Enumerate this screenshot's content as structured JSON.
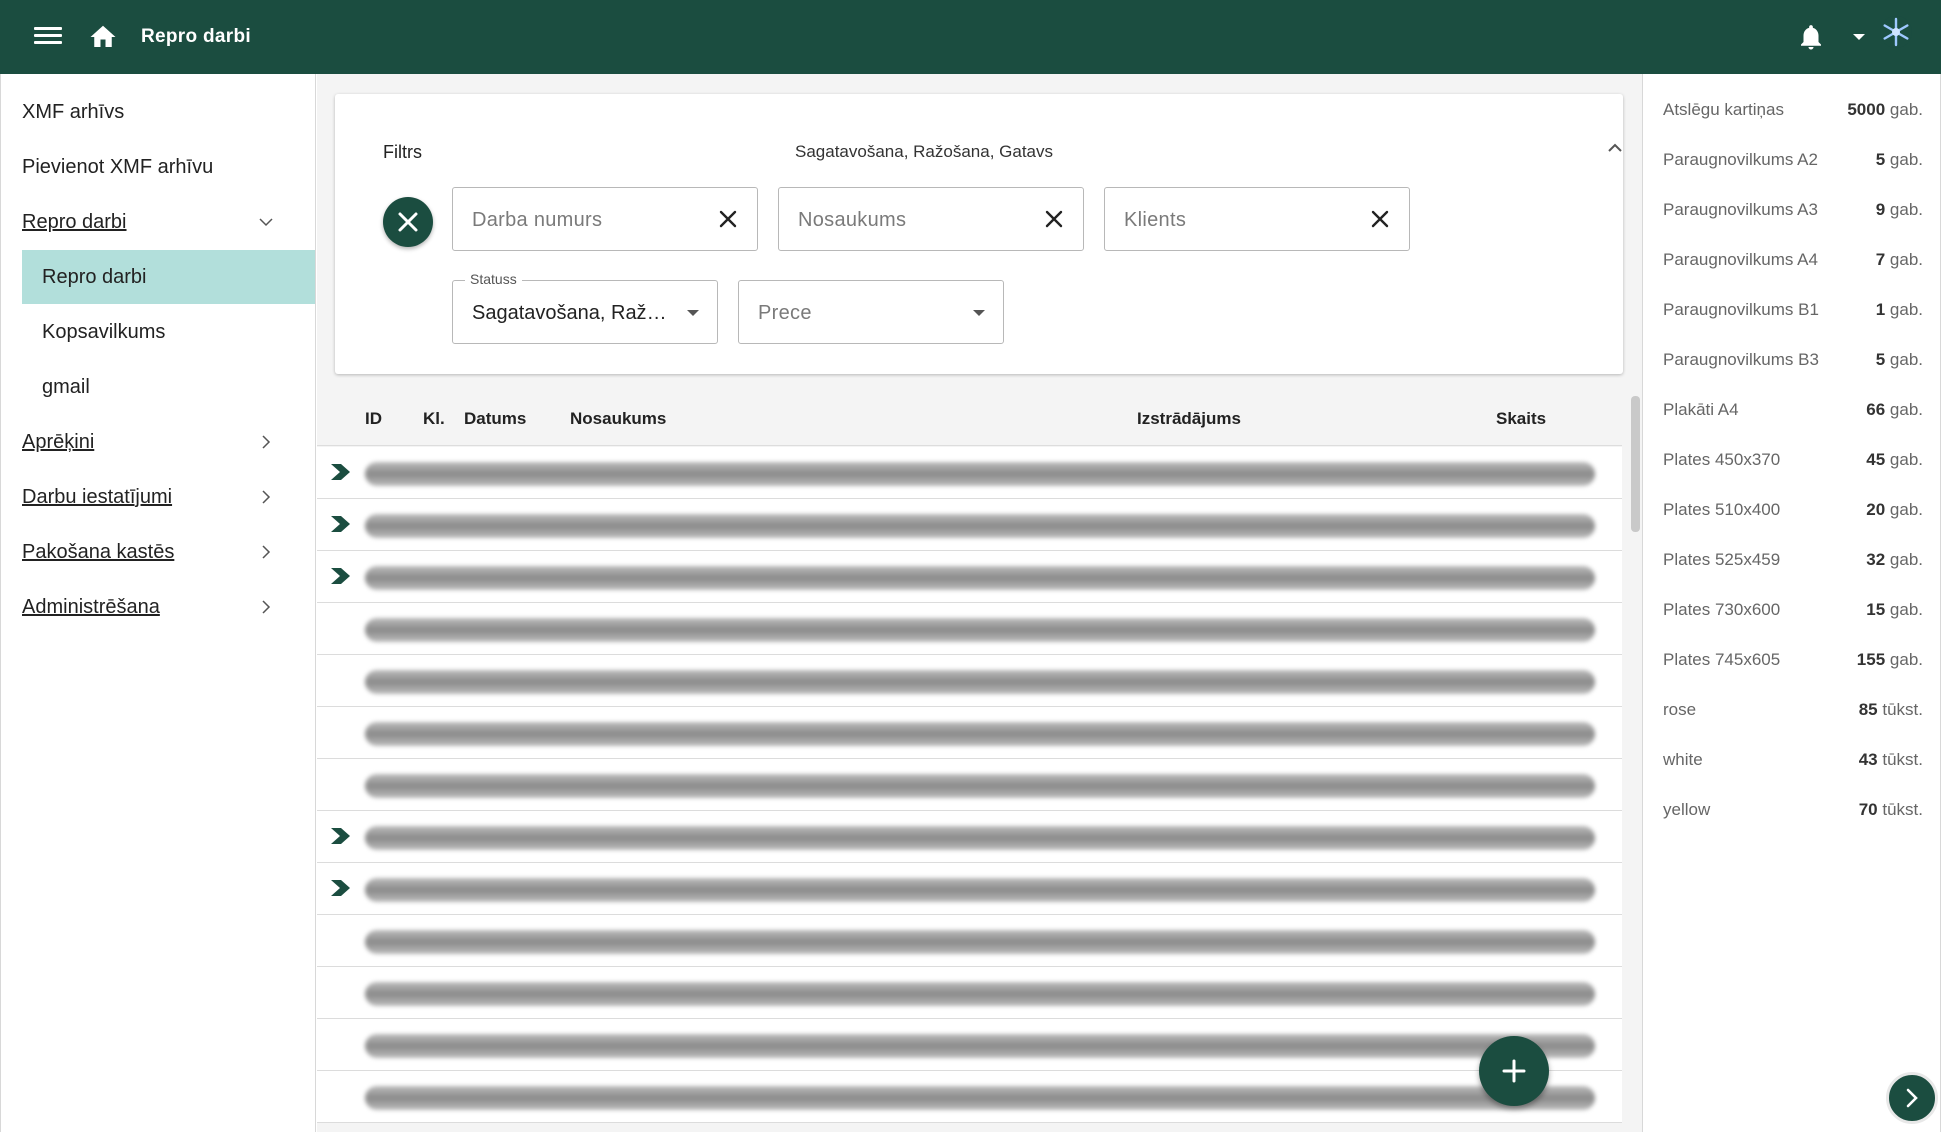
{
  "topbar": {
    "title": "Repro darbi"
  },
  "sidebar": {
    "items": [
      {
        "label": "XMF arhīvs"
      },
      {
        "label": "Pievienot XMF arhīvu"
      },
      {
        "label": "Repro darbi"
      },
      {
        "label": "Aprēķini"
      },
      {
        "label": "Darbu iestatījumi"
      },
      {
        "label": "Pakošana kastēs"
      },
      {
        "label": "Administrēšana"
      }
    ],
    "subitems": [
      {
        "label": "Repro darbi"
      },
      {
        "label": "Kopsavilkums"
      },
      {
        "label": "gmail"
      }
    ]
  },
  "filter": {
    "title": "Filtrs",
    "summary": "Sagatavošana, Ražošana, Gatavs",
    "job_number_placeholder": "Darba numurs",
    "name_placeholder": "Nosaukums",
    "client_placeholder": "Klients",
    "status_label": "Statuss",
    "status_value": "Sagatavošana, Ražo...",
    "product_placeholder": "Prece"
  },
  "table": {
    "headers": {
      "id": "ID",
      "kl": "Kl.",
      "date": "Datums",
      "name": "Nosaukums",
      "product": "Izstrādājums",
      "count": "Skaits"
    }
  },
  "stats": [
    {
      "name": "Atslēgu kartiņas",
      "value": "5000",
      "unit": "gab."
    },
    {
      "name": "Paraugnovilkums A2",
      "value": "5",
      "unit": "gab."
    },
    {
      "name": "Paraugnovilkums A3",
      "value": "9",
      "unit": "gab."
    },
    {
      "name": "Paraugnovilkums A4",
      "value": "7",
      "unit": "gab."
    },
    {
      "name": "Paraugnovilkums B1",
      "value": "1",
      "unit": "gab."
    },
    {
      "name": "Paraugnovilkums B3",
      "value": "5",
      "unit": "gab."
    },
    {
      "name": "Plakāti A4",
      "value": "66",
      "unit": "gab."
    },
    {
      "name": "Plates 450x370",
      "value": "45",
      "unit": "gab."
    },
    {
      "name": "Plates 510x400",
      "value": "20",
      "unit": "gab."
    },
    {
      "name": "Plates 525x459",
      "value": "32",
      "unit": "gab."
    },
    {
      "name": "Plates 730x600",
      "value": "15",
      "unit": "gab."
    },
    {
      "name": "Plates 745x605",
      "value": "155",
      "unit": "gab."
    },
    {
      "name": "rose",
      "value": "85",
      "unit": "tūkst."
    },
    {
      "name": "white",
      "value": "43",
      "unit": "tūkst."
    },
    {
      "name": "yellow",
      "value": "70",
      "unit": "tūkst."
    }
  ],
  "colors": {
    "primary": "#1b4d40",
    "active_nav": "#b2dfdb"
  },
  "icons": [
    "menu-icon",
    "home-icon",
    "bell-icon",
    "avatar-icon",
    "close-icon",
    "chevron-up-icon",
    "chevron-down-icon",
    "chevron-right-icon",
    "add-icon",
    "arrow-marker-icon"
  ]
}
